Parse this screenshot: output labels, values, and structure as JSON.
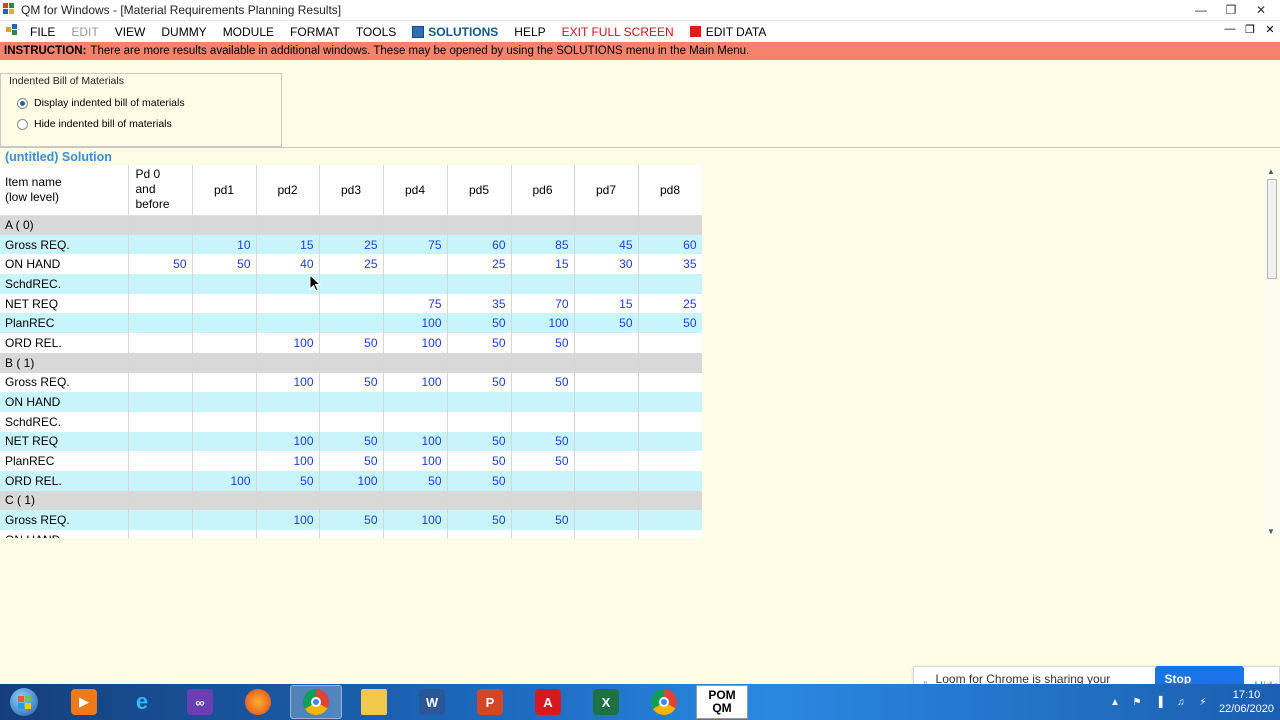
{
  "window": {
    "title": "QM for Windows - [Material Requirements Planning Results]"
  },
  "menu": {
    "items": [
      {
        "label": "FILE"
      },
      {
        "label": "EDIT"
      },
      {
        "label": "VIEW"
      },
      {
        "label": "DUMMY"
      },
      {
        "label": "MODULE"
      },
      {
        "label": "FORMAT"
      },
      {
        "label": "TOOLS"
      },
      {
        "label": "SOLUTIONS"
      },
      {
        "label": "HELP"
      },
      {
        "label": "EXIT FULL SCREEN"
      },
      {
        "label": "EDIT DATA"
      }
    ]
  },
  "instruction": {
    "label": "INSTRUCTION:",
    "text": "There are more results available in additional windows. These may be opened by using the SOLUTIONS menu in the Main Menu."
  },
  "bom": {
    "title": "Indented Bill of Materials",
    "options": [
      {
        "label": "Display indented bill of materials",
        "checked": true
      },
      {
        "label": "Hide indented bill of materials",
        "checked": false
      }
    ]
  },
  "solution_title": "(untitled) Solution",
  "table": {
    "headers": [
      "Item name\n(low level)",
      "Pd 0\nand\nbefore",
      "pd1",
      "pd2",
      "pd3",
      "pd4",
      "pd5",
      "pd6",
      "pd7",
      "pd8"
    ],
    "rows": [
      {
        "style": "gray",
        "cells": [
          "A ( 0)",
          "",
          "",
          "",
          "",
          "",
          "",
          "",
          "",
          ""
        ]
      },
      {
        "style": "cyan",
        "cells": [
          "Gross REQ.",
          "",
          "10",
          "15",
          "25",
          "75",
          "60",
          "85",
          "45",
          "60"
        ]
      },
      {
        "style": "white",
        "cells": [
          "ON HAND",
          "50",
          "50",
          "40",
          "25",
          "",
          "25",
          "15",
          "30",
          "35"
        ]
      },
      {
        "style": "cyan",
        "cells": [
          "SchdREC.",
          "",
          "",
          "",
          "",
          "",
          "",
          "",
          "",
          ""
        ]
      },
      {
        "style": "white",
        "cells": [
          "NET REQ",
          "",
          "",
          "",
          "",
          "75",
          "35",
          "70",
          "15",
          "25"
        ]
      },
      {
        "style": "cyan",
        "cells": [
          "PlanREC",
          "",
          "",
          "",
          "",
          "100",
          "50",
          "100",
          "50",
          "50"
        ]
      },
      {
        "style": "white",
        "cells": [
          "ORD REL.",
          "",
          "",
          "100",
          "50",
          "100",
          "50",
          "50",
          "",
          ""
        ]
      },
      {
        "style": "gray",
        "cells": [
          "B ( 1)",
          "",
          "",
          "",
          "",
          "",
          "",
          "",
          "",
          ""
        ]
      },
      {
        "style": "white",
        "cells": [
          "Gross REQ.",
          "",
          "",
          "100",
          "50",
          "100",
          "50",
          "50",
          "",
          ""
        ]
      },
      {
        "style": "cyan",
        "cells": [
          "ON HAND",
          "",
          "",
          "",
          "",
          "",
          "",
          "",
          "",
          ""
        ]
      },
      {
        "style": "white",
        "cells": [
          "SchdREC.",
          "",
          "",
          "",
          "",
          "",
          "",
          "",
          "",
          ""
        ]
      },
      {
        "style": "cyan",
        "cells": [
          "NET REQ",
          "",
          "",
          "100",
          "50",
          "100",
          "50",
          "50",
          "",
          ""
        ]
      },
      {
        "style": "white",
        "cells": [
          "PlanREC",
          "",
          "",
          "100",
          "50",
          "100",
          "50",
          "50",
          "",
          ""
        ]
      },
      {
        "style": "cyan",
        "cells": [
          "ORD REL.",
          "",
          "100",
          "50",
          "100",
          "50",
          "50",
          "",
          "",
          ""
        ]
      },
      {
        "style": "gray",
        "cells": [
          "C ( 1)",
          "",
          "",
          "",
          "",
          "",
          "",
          "",
          "",
          ""
        ]
      },
      {
        "style": "cyan",
        "cells": [
          "Gross REQ.",
          "",
          "",
          "100",
          "50",
          "100",
          "50",
          "50",
          "",
          ""
        ]
      },
      {
        "style": "white",
        "cells": [
          "ON HAND",
          "",
          "",
          "",
          "",
          "",
          "",
          "",
          "",
          ""
        ]
      }
    ]
  },
  "loom": {
    "message": "Loom for Chrome is sharing your screen.",
    "stop_label": "Stop sharing",
    "hide_label": "Hide"
  },
  "taskbar": {
    "apps": [
      "start-orb",
      "media-player",
      "internet-explorer",
      "visual-studio",
      "firefox",
      "chrome",
      "file-explorer",
      "word",
      "powerpoint",
      "acrobat",
      "excel",
      "chrome"
    ],
    "pom_line1": "POM",
    "pom_line2": "QM",
    "time": "17:10",
    "date": "22/06/2020"
  },
  "colors": {
    "instruction_bg": "#f4836a",
    "main_bg": "#fdfce4",
    "cyan_row": "#c8f5fb",
    "gray_row": "#d8d8d8",
    "number_text": "#1f3fd6",
    "solution_title": "#3a8fd6",
    "loom_button": "#1a73e8"
  }
}
